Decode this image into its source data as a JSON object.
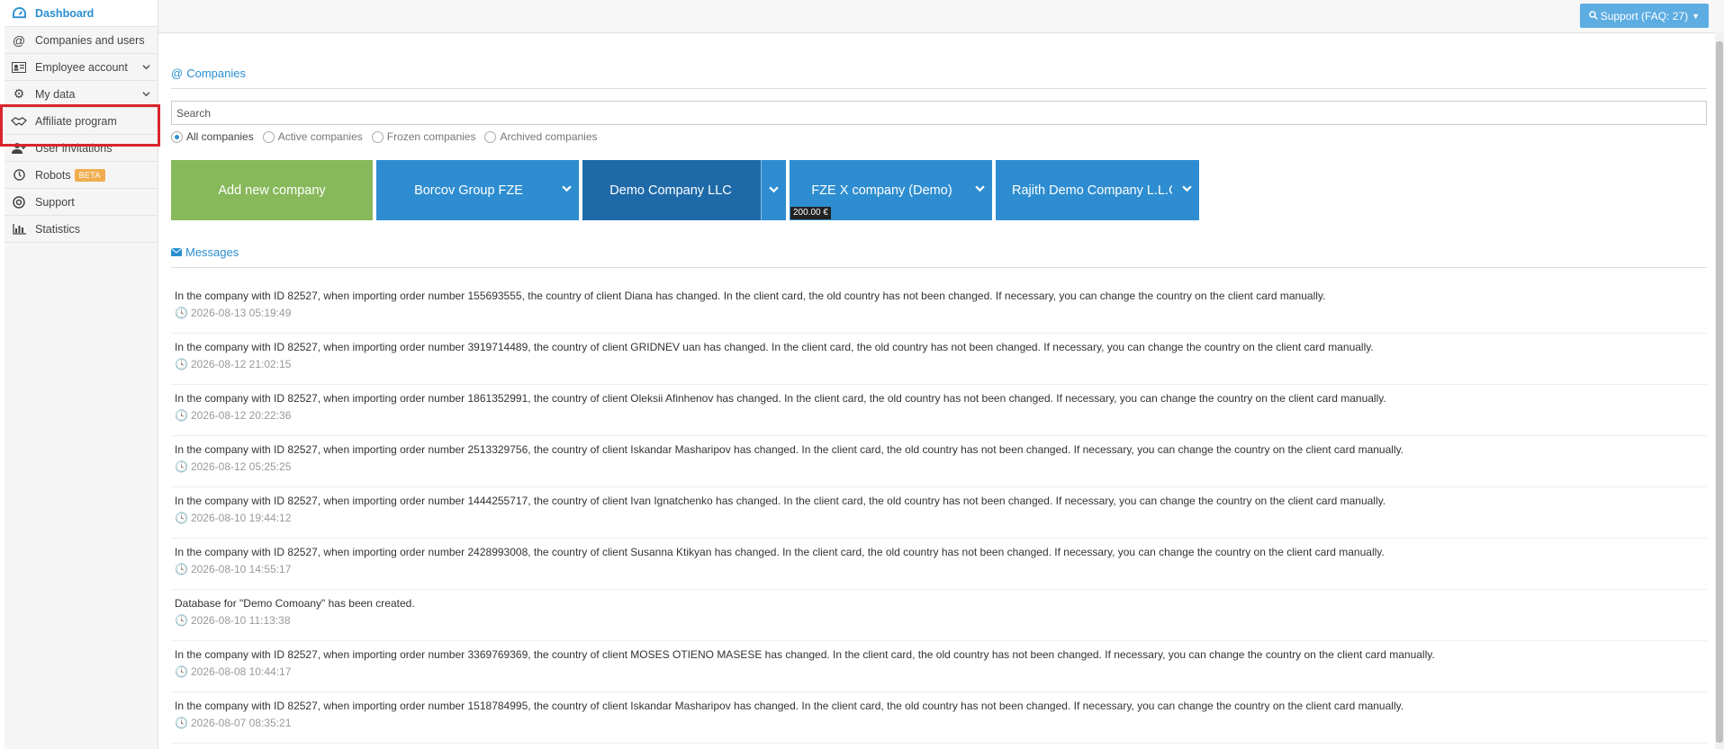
{
  "sidebar": {
    "items": [
      {
        "label": "Dashboard",
        "icon": "dashboard-icon"
      },
      {
        "label": "Companies and users",
        "icon": "at-icon"
      },
      {
        "label": "Employee account",
        "icon": "id-card-icon"
      },
      {
        "label": "My data",
        "icon": "gears-icon"
      },
      {
        "label": "Affiliate program",
        "icon": "handshake-icon"
      },
      {
        "label": "User invitations",
        "icon": "user-plus-icon"
      },
      {
        "label": "Robots",
        "icon": "clock-icon",
        "badge": "BETA"
      },
      {
        "label": "Support",
        "icon": "lifebuoy-icon"
      },
      {
        "label": "Statistics",
        "icon": "bar-chart-icon"
      }
    ]
  },
  "topbar": {
    "support_label": "Support (FAQ: 27)"
  },
  "companies": {
    "title": "Companies",
    "search_placeholder": "Search",
    "filters": [
      "All companies",
      "Active companies",
      "Frozen companies",
      "Archived companies"
    ],
    "selected_filter": "All companies",
    "add_label": "Add new company",
    "tiles": [
      {
        "label": "Borcov Group FZE"
      },
      {
        "label": "Demo Company LLC"
      },
      {
        "label": "FZE X company (Demo)",
        "price": "200.00 €"
      },
      {
        "label": "Rajith Demo Company L.L.C"
      }
    ]
  },
  "messages": {
    "title": "Messages",
    "items": [
      {
        "text": "In the company with ID 82527, when importing order number 155693555, the country of client Diana has changed. In the client card, the old country has not been changed. If necessary, you can change the country on the client card manually.",
        "time": "2026-08-13 05:19:49"
      },
      {
        "text": "In the company with ID 82527, when importing order number 3919714489, the country of client GRIDNEV uan has changed. In the client card, the old country has not been changed. If necessary, you can change the country on the client card manually.",
        "time": "2026-08-12 21:02:15"
      },
      {
        "text": "In the company with ID 82527, when importing order number 1861352991, the country of client Oleksii Afinhenov has changed. In the client card, the old country has not been changed. If necessary, you can change the country on the client card manually.",
        "time": "2026-08-12 20:22:36"
      },
      {
        "text": "In the company with ID 82527, when importing order number 2513329756, the country of client Iskandar Masharipov has changed. In the client card, the old country has not been changed. If necessary, you can change the country on the client card manually.",
        "time": "2026-08-12 05:25:25"
      },
      {
        "text": "In the company with ID 82527, when importing order number 1444255717, the country of client Ivan Ignatchenko has changed. In the client card, the old country has not been changed. If necessary, you can change the country on the client card manually.",
        "time": "2026-08-10 19:44:12"
      },
      {
        "text": "In the company with ID 82527, when importing order number 2428993008, the country of client Susanna Ktikyan has changed. In the client card, the old country has not been changed. If necessary, you can change the country on the client card manually.",
        "time": "2026-08-10 14:55:17"
      },
      {
        "text": "Database for \"Demo Comoany\" has been created.",
        "time": "2026-08-10 11:13:38"
      },
      {
        "text": "In the company with ID 82527, when importing order number 3369769369, the country of client MOSES OTIENO MASESE has changed. In the client card, the old country has not been changed. If necessary, you can change the country on the client card manually.",
        "time": "2026-08-08 10:44:17"
      },
      {
        "text": "In the company with ID 82527, when importing order number 1518784995, the country of client Iskandar Masharipov has changed. In the client card, the old country has not been changed. If necessary, you can change the country on the client card manually.",
        "time": "2026-08-07 08:35:21"
      }
    ]
  },
  "colors": {
    "accent": "#2a8fd0",
    "green": "#87b85a",
    "tile_blue": "#2e8dd0",
    "tile_dark": "#1e6aa8",
    "highlight": "#d9262c"
  }
}
